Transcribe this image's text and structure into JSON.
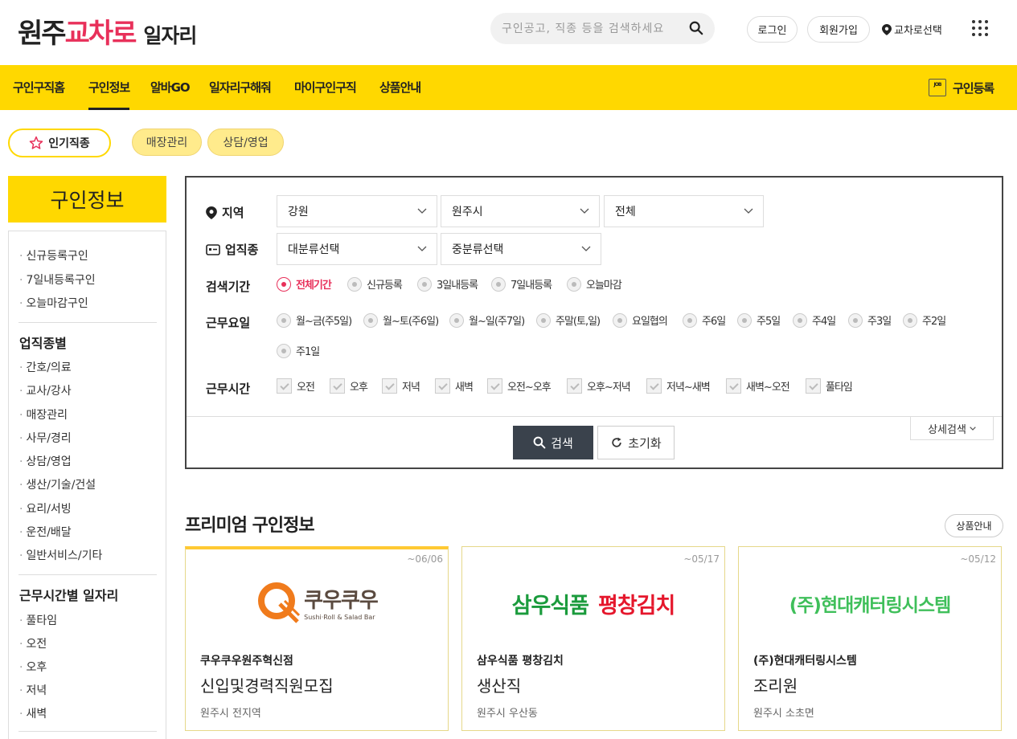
{
  "header": {
    "logo_part1": "원주",
    "logo_part2": "교차로",
    "logo_part3": "일자리",
    "search_placeholder": "구인공고, 직종 등을 검색하세요",
    "login": "로그인",
    "join": "회원가입",
    "region_select": "교차로선택"
  },
  "nav": {
    "items": [
      "구인구직홈",
      "구인정보",
      "알바GO",
      "일자리구해줘",
      "마이구인구직",
      "상품안내"
    ],
    "active": 1,
    "register": "구인등록",
    "job_icon_text": "JOB"
  },
  "tags": {
    "popular": "인기직종",
    "items": [
      "매장관리",
      "상담/영업"
    ]
  },
  "sidebar": {
    "title": "구인정보",
    "quick_links": [
      "신규등록구인",
      "7일내등록구인",
      "오늘마감구인"
    ],
    "section1_title": "업직종별",
    "section1_items": [
      "간호/의료",
      "교사/강사",
      "매장관리",
      "사무/경리",
      "상담/영업",
      "생산/기술/건설",
      "요리/서빙",
      "운전/배달",
      "일반서비스/기타"
    ],
    "section2_title": "근무시간별 일자리",
    "section2_items": [
      "풀타임",
      "오전",
      "오후",
      "저녁",
      "새벽"
    ]
  },
  "search": {
    "region_label": "지역",
    "region_values": [
      "강원",
      "원주시",
      "전체"
    ],
    "category_label": "업직종",
    "category_values": [
      "대분류선택",
      "중분류선택"
    ],
    "period_label": "검색기간",
    "period_options": [
      "전체기간",
      "신규등록",
      "3일내등록",
      "7일내등록",
      "오늘마감"
    ],
    "period_selected": 0,
    "days_label": "근무요일",
    "days_options": [
      "월~금(주5일)",
      "월~토(주6일)",
      "월~일(주7일)",
      "주말(토,일)",
      "요일협의",
      "주6일",
      "주5일",
      "주4일",
      "주3일",
      "주2일",
      "주1일"
    ],
    "hours_label": "근무시간",
    "hours_options": [
      "오전",
      "오후",
      "저녁",
      "새벽",
      "오전~오후",
      "오후~저녁",
      "저녁~새벽",
      "새벽~오전",
      "풀타임"
    ],
    "search_btn": "검색",
    "reset_btn": "초기화",
    "detail_btn": "상세검색"
  },
  "premium": {
    "title": "프리미엄 구인정보",
    "product_btn": "상품안내",
    "cards": [
      {
        "date": "~06/06",
        "logo_text": "쿠우쿠우",
        "logo_sub": "Sushi·Roll & Salad Bar",
        "company": "쿠우쿠우원주혁신점",
        "title": "신입및경력직원모집",
        "location": "원주시 전지역"
      },
      {
        "date": "~05/17",
        "logo_text_green": "삼우식품",
        "logo_text_red": "평창김치",
        "company": "삼우식품 평창김치",
        "title": "생산직",
        "location": "원주시 우산동"
      },
      {
        "date": "~05/12",
        "logo_text": "(주)현대캐터링시스템",
        "company": "(주)현대캐터링시스템",
        "title": "조리원",
        "location": "원주시 소초면"
      }
    ]
  },
  "colors": {
    "brand_yellow": "#ffd800",
    "brand_pink": "#e8305a",
    "dark_btn": "#3a424c"
  }
}
